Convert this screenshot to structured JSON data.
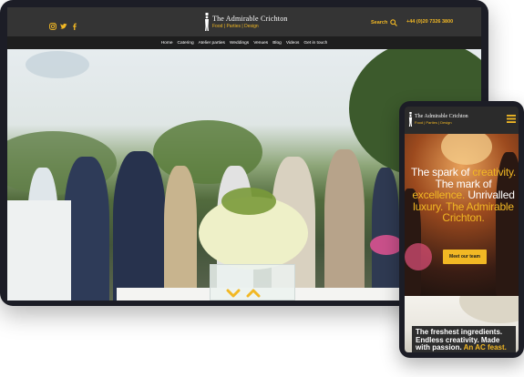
{
  "desktop": {
    "brand": {
      "name": "The Admirable Crichton",
      "tagline": "Food | Parties | Design"
    },
    "social_icons": [
      "instagram-icon",
      "twitter-icon",
      "facebook-icon"
    ],
    "search_label": "Search",
    "phone": "+44 (0)20 7326 3800",
    "nav": [
      "Home",
      "Catering",
      "Atelier parties",
      "Weddings",
      "Venues",
      "Blog",
      "Videos",
      "Get in touch"
    ],
    "hero_controls": [
      "chevron-down-icon",
      "chevron-up-icon"
    ]
  },
  "mobile": {
    "brand": {
      "name": "The Admirable Crichton",
      "tagline": "Food | Parties | Design"
    },
    "menu_icon": "hamburger-icon",
    "headline": {
      "w1": "The spark of",
      "y1": "creativity.",
      "w2": "The mark of",
      "y2": "excellence.",
      "w3": "Unrivalled",
      "y3": "luxury.",
      "y4": "The Admirable Crichton."
    },
    "cta": "Meet our team",
    "caption": {
      "w": "The freshest ingredients. Endless creativity. Made with passion.",
      "y": "An AC feast."
    }
  },
  "colors": {
    "accent": "#f2b824",
    "header": "#343434",
    "frame": "#1c1d26"
  }
}
